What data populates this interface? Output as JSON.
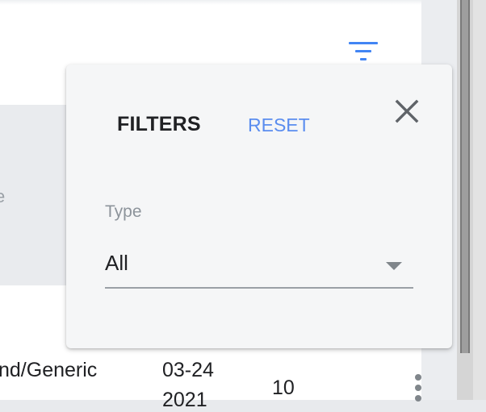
{
  "filter_panel": {
    "title": "FILTERS",
    "reset_label": "RESET",
    "close_icon": "close-icon",
    "type_field": {
      "label": "Type",
      "value": "All"
    }
  },
  "toolbar": {
    "filter_icon": "filter-list-icon"
  },
  "background_table": {
    "clipped_header_fragment": "e",
    "row": {
      "type_fragment": "nd/Generic",
      "date_fragment": "03-24",
      "year_fragment": "2021",
      "count": "10",
      "menu_icon": "more-vert-icon"
    }
  },
  "colors": {
    "accent": "#4285f4",
    "reset_text": "#5b8def",
    "panel_bg": "#f5f6f7"
  }
}
